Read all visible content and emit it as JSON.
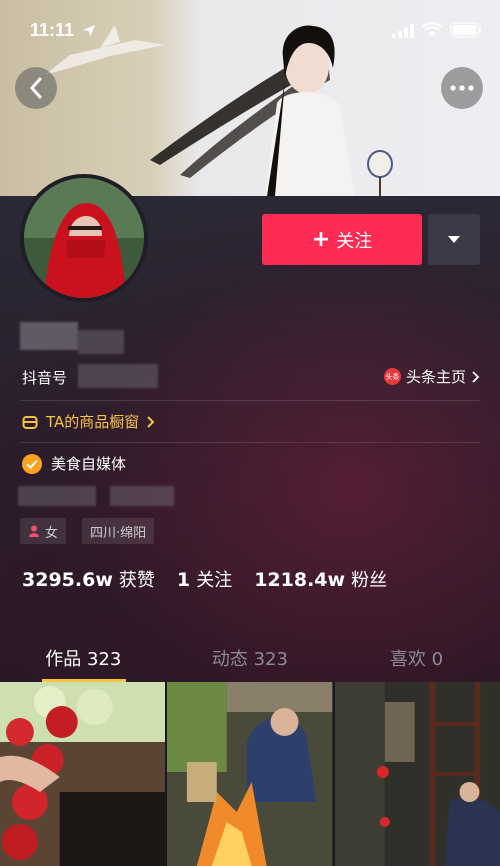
{
  "status_bar": {
    "time": "11:11"
  },
  "profile": {
    "douyin_id_label": "抖音号",
    "toutiao_link": "头条主页",
    "toutiao_badge": "头条",
    "shop_window": "TA的商品橱窗",
    "verified_category": "美食自媒体",
    "tags": {
      "gender": "女",
      "location": "四川·绵阳"
    }
  },
  "actions": {
    "follow_label": "关注",
    "follow_plus": "+"
  },
  "stats": [
    {
      "num": "3295.6w",
      "label": "获赞"
    },
    {
      "num": "1",
      "label": "关注"
    },
    {
      "num": "1218.4w",
      "label": "粉丝"
    }
  ],
  "tabs": [
    {
      "label": "作品 323"
    },
    {
      "label": "动态 323"
    },
    {
      "label": "喜欢 0"
    }
  ],
  "colors": {
    "follow": "#fe2c55",
    "accent_yellow": "#f6c343",
    "verified": "#f8a21d"
  }
}
